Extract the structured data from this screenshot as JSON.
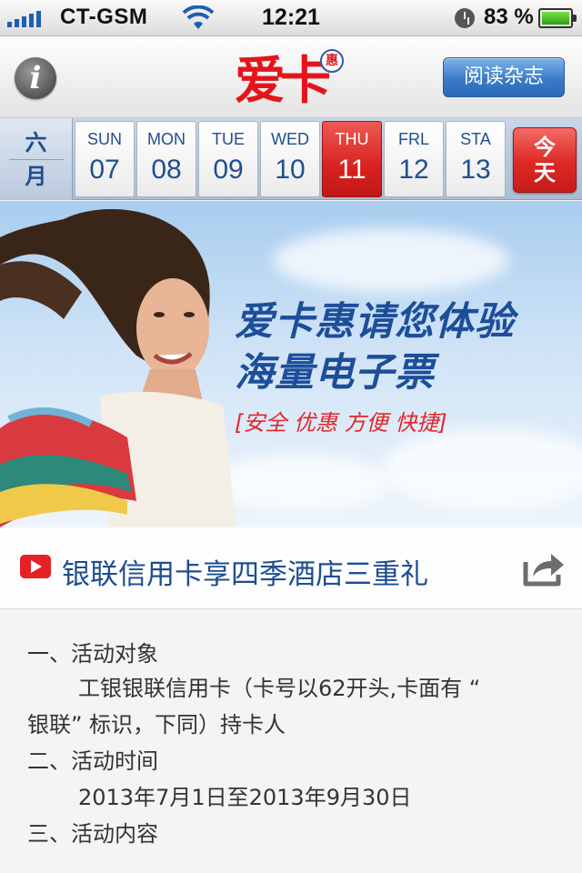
{
  "status_bar": {
    "carrier": "CT-GSM",
    "time": "12:21",
    "battery_percent": "83 %",
    "signal_bars": 5,
    "icons": [
      "signal-icon",
      "wifi-icon",
      "clock-icon",
      "battery-icon"
    ]
  },
  "header": {
    "info_label": "i",
    "logo_text": "爱卡",
    "logo_badge": "惠",
    "read_button": "阅读杂志"
  },
  "calendar": {
    "month_top": "六",
    "month_bottom": "月",
    "days": [
      {
        "name": "SUN",
        "date": "07"
      },
      {
        "name": "MON",
        "date": "08"
      },
      {
        "name": "TUE",
        "date": "09"
      },
      {
        "name": "WED",
        "date": "10"
      },
      {
        "name": "THU",
        "date": "11"
      },
      {
        "name": "FRL",
        "date": "12"
      },
      {
        "name": "STA",
        "date": "13"
      }
    ],
    "selected_day": "THU",
    "today_top": "今",
    "today_bottom": "天"
  },
  "banner": {
    "line1": "爱卡惠请您体验",
    "line2": "海量电子票",
    "tagline": "[安全  优惠  方便  快捷]"
  },
  "article": {
    "title": "银联信用卡享四季酒店三重礼",
    "paragraphs": [
      " 一、活动对象",
      "工银银联信用卡（卡号以62开头,卡面有 “",
      "银联” 标识，下同）持卡人",
      "二、活动时间",
      "2013年7月1日至2013年9月30日",
      "三、活动内容"
    ]
  },
  "colors": {
    "accent_blue": "#1d4e8f",
    "accent_red": "#e32126",
    "calendar_bg": "#b9c9dd"
  }
}
